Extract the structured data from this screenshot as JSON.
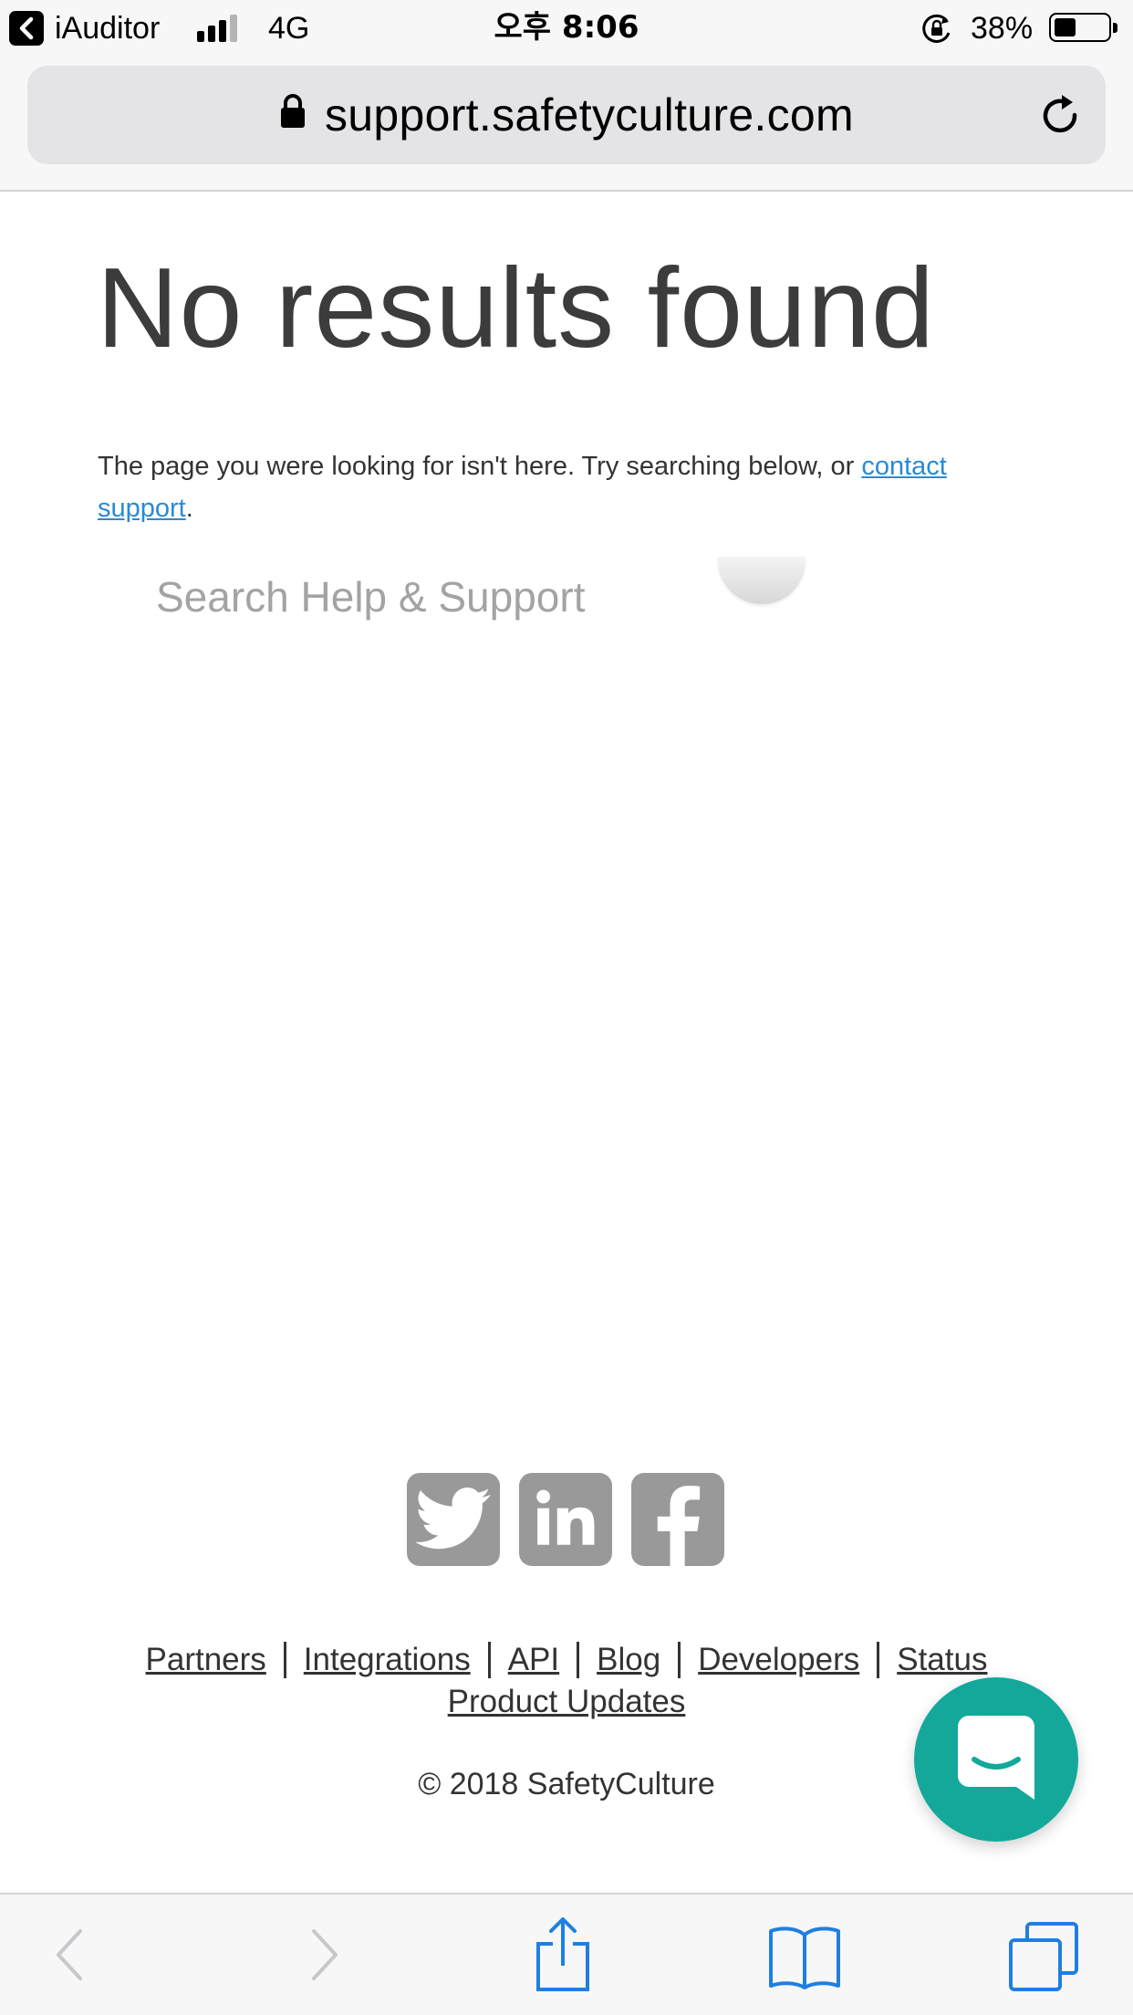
{
  "status_bar": {
    "back_app": "iAuditor",
    "network": "4G",
    "time": "오후 8:06",
    "battery_percent": "38%",
    "battery_level": 0.38,
    "signal_bars_active": 3,
    "signal_bars_total": 4
  },
  "address_bar": {
    "url": "support.safetyculture.com",
    "secure_icon": "lock-icon",
    "reload_icon": "reload-icon"
  },
  "page": {
    "title": "No results found",
    "intro_before_link": "The page you were looking for isn't here. Try searching below, or ",
    "contact_link": "contact support",
    "intro_after_link": ".",
    "search_placeholder": "Search Help & Support"
  },
  "footer": {
    "social": [
      "twitter-icon",
      "linkedin-icon",
      "facebook-icon"
    ],
    "links": [
      "Partners",
      "Integrations",
      "API",
      "Blog",
      "Developers",
      "Status"
    ],
    "links_line2": "Product Updates",
    "copyright": "© 2018 SafetyCulture"
  },
  "chat": {
    "icon": "chat-bubble-icon",
    "color": "#13a89a"
  },
  "toolbar": {
    "items": [
      "back-icon",
      "forward-icon",
      "share-icon",
      "bookmarks-icon",
      "tabs-icon"
    ],
    "accent": "#1f7fe0"
  }
}
